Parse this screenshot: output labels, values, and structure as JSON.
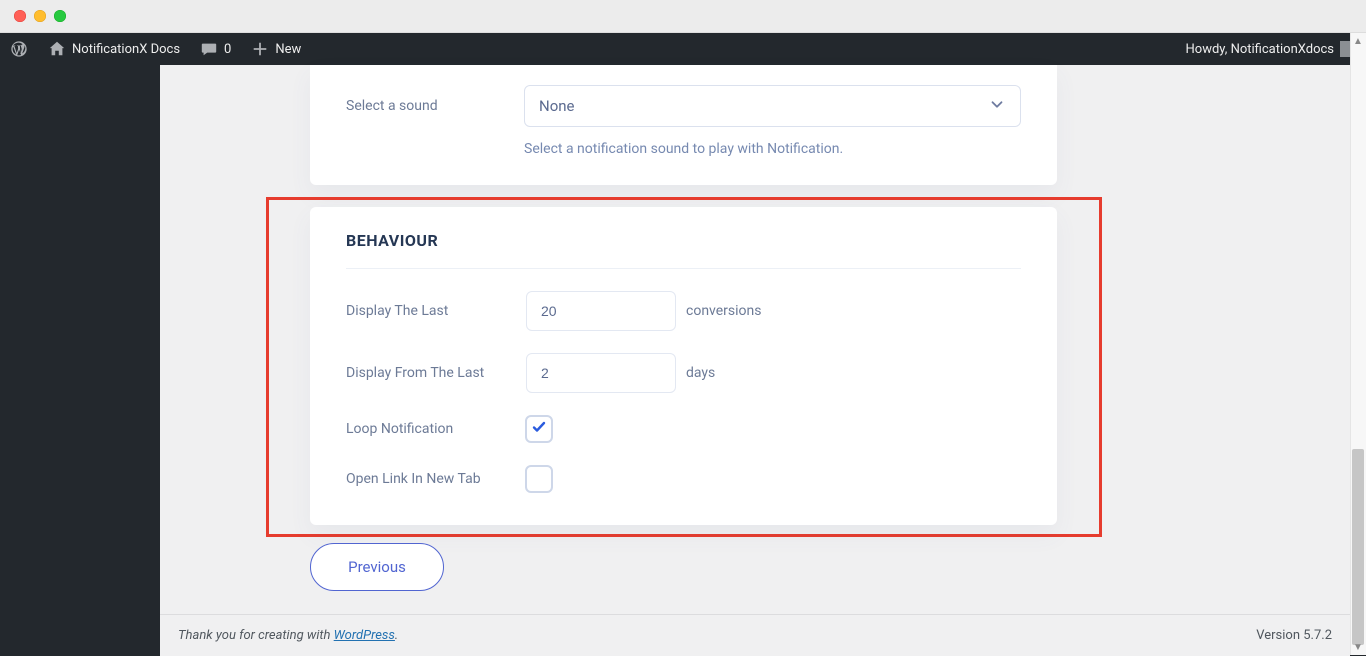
{
  "adminbar": {
    "site_title": "NotificationX Docs",
    "comments_count": "0",
    "new_label": "New",
    "howdy_prefix": "Howdy, ",
    "user_name": "NotificationXdocs"
  },
  "sound_section": {
    "label": "Select a sound",
    "selected_option": "None",
    "hint": "Select a notification sound to play with Notification."
  },
  "behaviour": {
    "title": "BEHAVIOUR",
    "display_last_label": "Display The Last",
    "display_last_value": "20",
    "display_last_suffix": "conversions",
    "display_from_last_label": "Display From The Last",
    "display_from_last_value": "2",
    "display_from_last_suffix": "days",
    "loop_label": "Loop Notification",
    "loop_checked": true,
    "open_link_label": "Open Link In New Tab",
    "open_link_checked": false
  },
  "nav": {
    "previous_label": "Previous"
  },
  "footer": {
    "thank_prefix": "Thank you for creating with ",
    "wp_link": "WordPress",
    "thank_suffix": ".",
    "version_label": "Version 5.7.2"
  }
}
